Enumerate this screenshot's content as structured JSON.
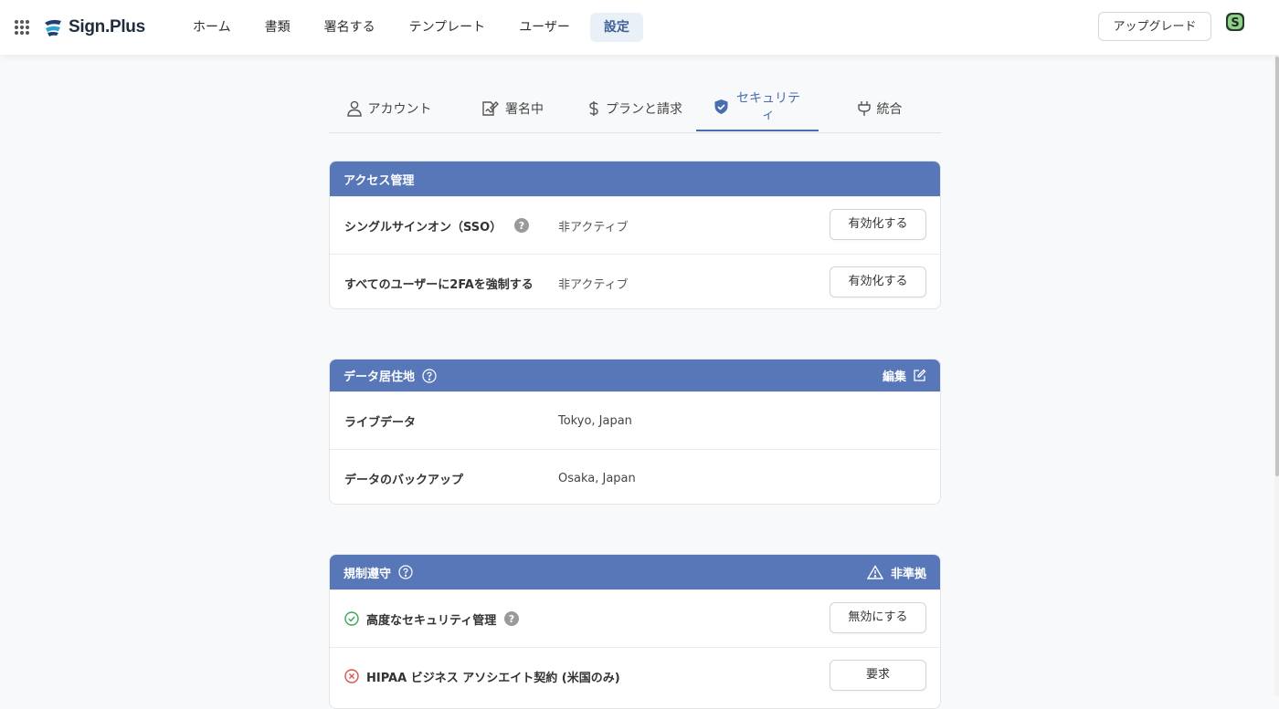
{
  "app": {
    "name": "Sign.Plus"
  },
  "nav": {
    "items": [
      {
        "label": "ホーム"
      },
      {
        "label": "書類"
      },
      {
        "label": "署名する"
      },
      {
        "label": "テンプレート"
      },
      {
        "label": "ユーザー"
      },
      {
        "label": "設定"
      }
    ],
    "active_index": 5,
    "upgrade_label": "アップグレード"
  },
  "tabs": [
    {
      "label": "アカウント",
      "icon": "user-icon"
    },
    {
      "label": "署名中",
      "icon": "signature-icon"
    },
    {
      "label": "プランと請求",
      "icon": "dollar-icon"
    },
    {
      "label": "セキュリティ",
      "icon": "shield-icon"
    },
    {
      "label": "統合",
      "icon": "plug-icon"
    }
  ],
  "active_tab": 3,
  "access": {
    "title": "アクセス管理",
    "rows": [
      {
        "label": "シングルサインオン（SSO）",
        "value": "非アクティブ",
        "button": "有効化する",
        "help": true
      },
      {
        "label": "すべてのユーザーに2FAを強制する",
        "value": "非アクティブ",
        "button": "有効化する"
      }
    ]
  },
  "residency": {
    "title": "データ居住地",
    "edit_label": "編集",
    "rows": [
      {
        "label": "ライブデータ",
        "value": "Tokyo, Japan"
      },
      {
        "label": "データのバックアップ",
        "value": "Osaka, Japan"
      }
    ]
  },
  "compliance": {
    "title": "規制遵守",
    "status_label": "非準拠",
    "rows": [
      {
        "label": "高度なセキュリティ管理",
        "status": "ok",
        "button": "無効にする",
        "help": true
      },
      {
        "label": "HIPAA ビジネス アソシエイト契約 (米国のみ)",
        "status": "error",
        "button": "要求"
      }
    ]
  },
  "colors": {
    "accent": "#5877b8",
    "active_tab": "#4b6cb0",
    "ok": "#3aa757",
    "error": "#d9534f"
  }
}
